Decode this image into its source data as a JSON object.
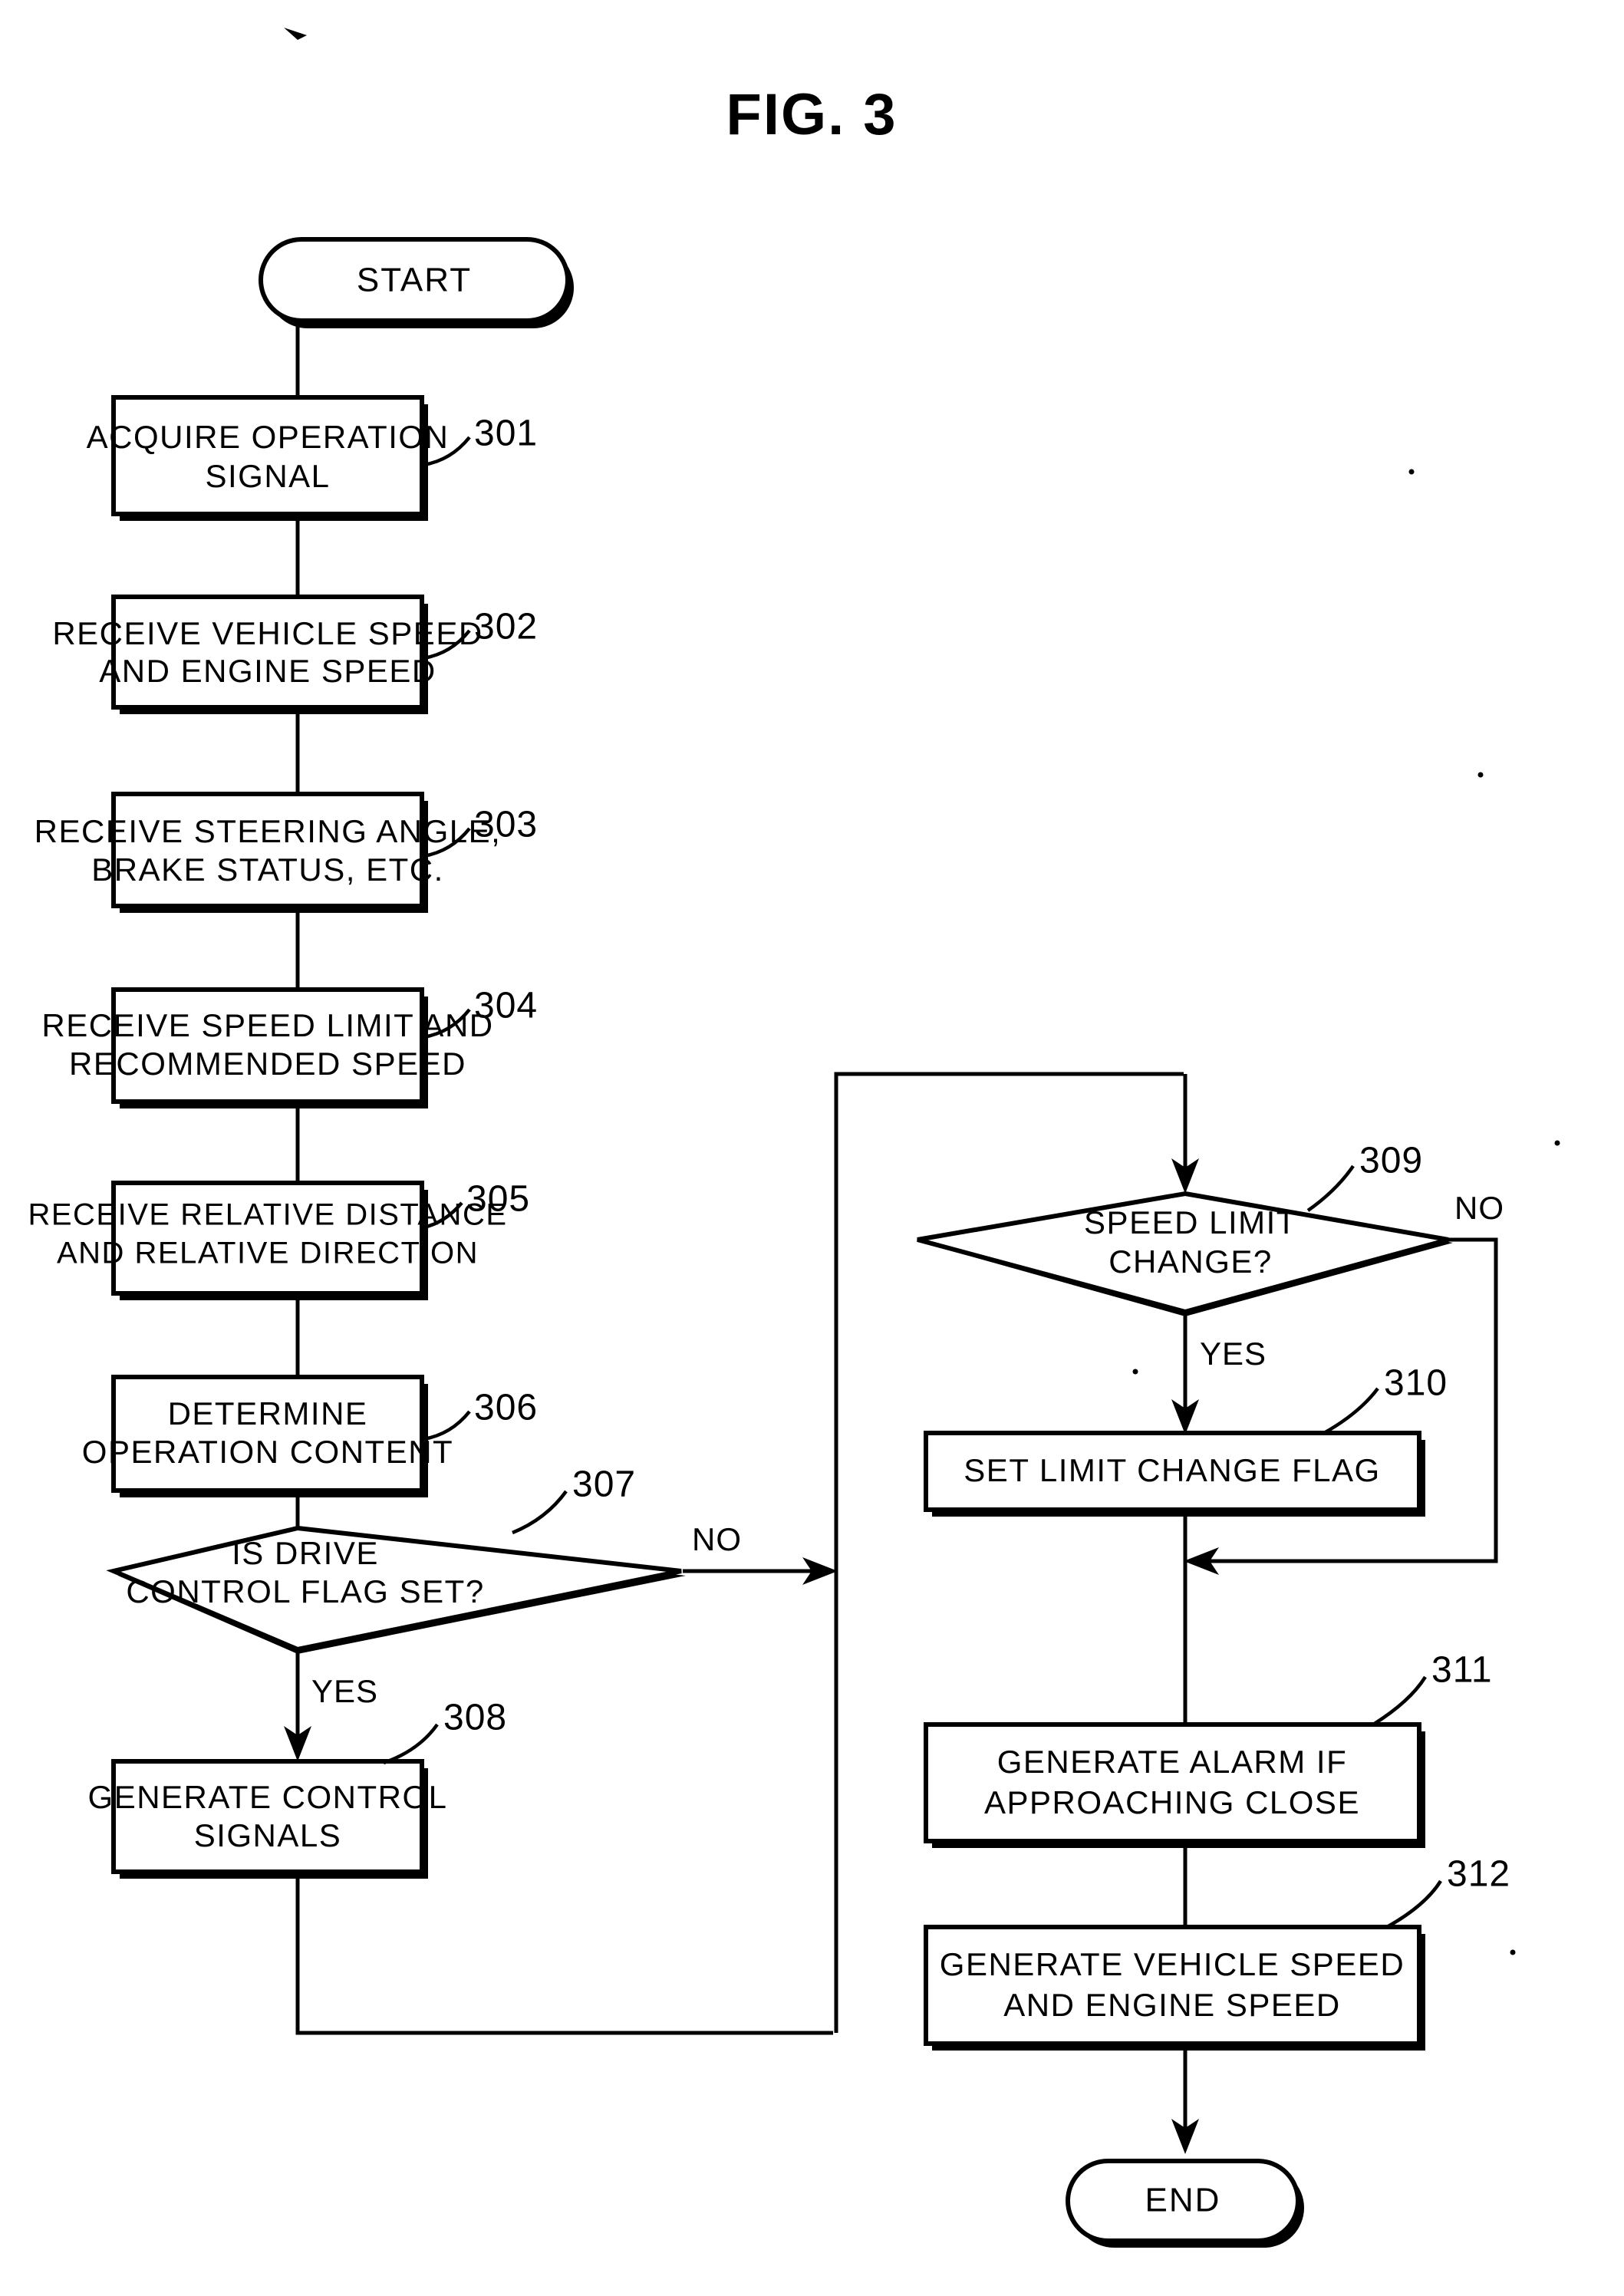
{
  "figure": {
    "title": "FIG. 3",
    "type": "patent-flowchart"
  },
  "terminators": {
    "start": "START",
    "end": "END"
  },
  "branch_labels": {
    "yes": "YES",
    "no": "NO"
  },
  "nodes": [
    {
      "ref": "301",
      "shape": "process",
      "lines": [
        "ACQUIRE OPERATION",
        "SIGNAL"
      ]
    },
    {
      "ref": "302",
      "shape": "process",
      "lines": [
        "RECEIVE VEHICLE SPEED",
        "AND ENGINE SPEED"
      ]
    },
    {
      "ref": "303",
      "shape": "process",
      "lines": [
        "RECEIVE STEERING ANGLE,",
        "BRAKE STATUS, ETC."
      ]
    },
    {
      "ref": "304",
      "shape": "process",
      "lines": [
        "RECEIVE SPEED LIMIT AND",
        "RECOMMENDED SPEED"
      ]
    },
    {
      "ref": "305",
      "shape": "process",
      "lines": [
        "RECEIVE RELATIVE DISTANCE",
        "AND RELATIVE DIRECTION"
      ]
    },
    {
      "ref": "306",
      "shape": "process",
      "lines": [
        "DETERMINE",
        "OPERATION CONTENT"
      ]
    },
    {
      "ref": "307",
      "shape": "decision",
      "lines": [
        "IS DRIVE",
        "CONTROL FLAG SET?"
      ]
    },
    {
      "ref": "308",
      "shape": "process",
      "lines": [
        "GENERATE CONTROL",
        "SIGNALS"
      ]
    },
    {
      "ref": "309",
      "shape": "decision",
      "lines": [
        "SPEED LIMIT",
        "CHANGE?"
      ]
    },
    {
      "ref": "310",
      "shape": "process",
      "lines": [
        "SET LIMIT CHANGE FLAG"
      ]
    },
    {
      "ref": "311",
      "shape": "process",
      "lines": [
        "GENERATE ALARM IF",
        "APPROACHING CLOSE"
      ]
    },
    {
      "ref": "312",
      "shape": "process",
      "lines": [
        "GENERATE VEHICLE SPEED",
        "AND ENGINE SPEED"
      ]
    }
  ],
  "colors": {
    "ink": "#000000",
    "paper": "#ffffff"
  }
}
